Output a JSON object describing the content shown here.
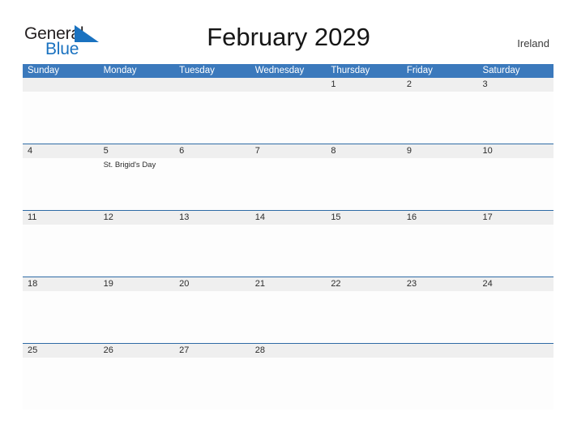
{
  "brand": {
    "name_part1": "General",
    "name_part2": "Blue",
    "flag_icon": "blue-triangle-flag-icon",
    "accent_color": "#1a72c0"
  },
  "header": {
    "title": "February 2029",
    "region": "Ireland"
  },
  "calendar": {
    "header_bg_color": "#3b79bc",
    "date_band_color": "#efefef",
    "rule_color": "#2f6ba5",
    "weekdays": [
      "Sunday",
      "Monday",
      "Tuesday",
      "Wednesday",
      "Thursday",
      "Friday",
      "Saturday"
    ],
    "weeks": [
      {
        "rule": false,
        "days": [
          {
            "number": "",
            "event": ""
          },
          {
            "number": "",
            "event": ""
          },
          {
            "number": "",
            "event": ""
          },
          {
            "number": "",
            "event": ""
          },
          {
            "number": "1",
            "event": ""
          },
          {
            "number": "2",
            "event": ""
          },
          {
            "number": "3",
            "event": ""
          }
        ]
      },
      {
        "rule": true,
        "days": [
          {
            "number": "4",
            "event": ""
          },
          {
            "number": "5",
            "event": "St. Brigid's Day"
          },
          {
            "number": "6",
            "event": ""
          },
          {
            "number": "7",
            "event": ""
          },
          {
            "number": "8",
            "event": ""
          },
          {
            "number": "9",
            "event": ""
          },
          {
            "number": "10",
            "event": ""
          }
        ]
      },
      {
        "rule": true,
        "days": [
          {
            "number": "11",
            "event": ""
          },
          {
            "number": "12",
            "event": ""
          },
          {
            "number": "13",
            "event": ""
          },
          {
            "number": "14",
            "event": ""
          },
          {
            "number": "15",
            "event": ""
          },
          {
            "number": "16",
            "event": ""
          },
          {
            "number": "17",
            "event": ""
          }
        ]
      },
      {
        "rule": true,
        "days": [
          {
            "number": "18",
            "event": ""
          },
          {
            "number": "19",
            "event": ""
          },
          {
            "number": "20",
            "event": ""
          },
          {
            "number": "21",
            "event": ""
          },
          {
            "number": "22",
            "event": ""
          },
          {
            "number": "23",
            "event": ""
          },
          {
            "number": "24",
            "event": ""
          }
        ]
      },
      {
        "rule": true,
        "days": [
          {
            "number": "25",
            "event": ""
          },
          {
            "number": "26",
            "event": ""
          },
          {
            "number": "27",
            "event": ""
          },
          {
            "number": "28",
            "event": ""
          },
          {
            "number": "",
            "event": ""
          },
          {
            "number": "",
            "event": ""
          },
          {
            "number": "",
            "event": ""
          }
        ]
      }
    ]
  }
}
